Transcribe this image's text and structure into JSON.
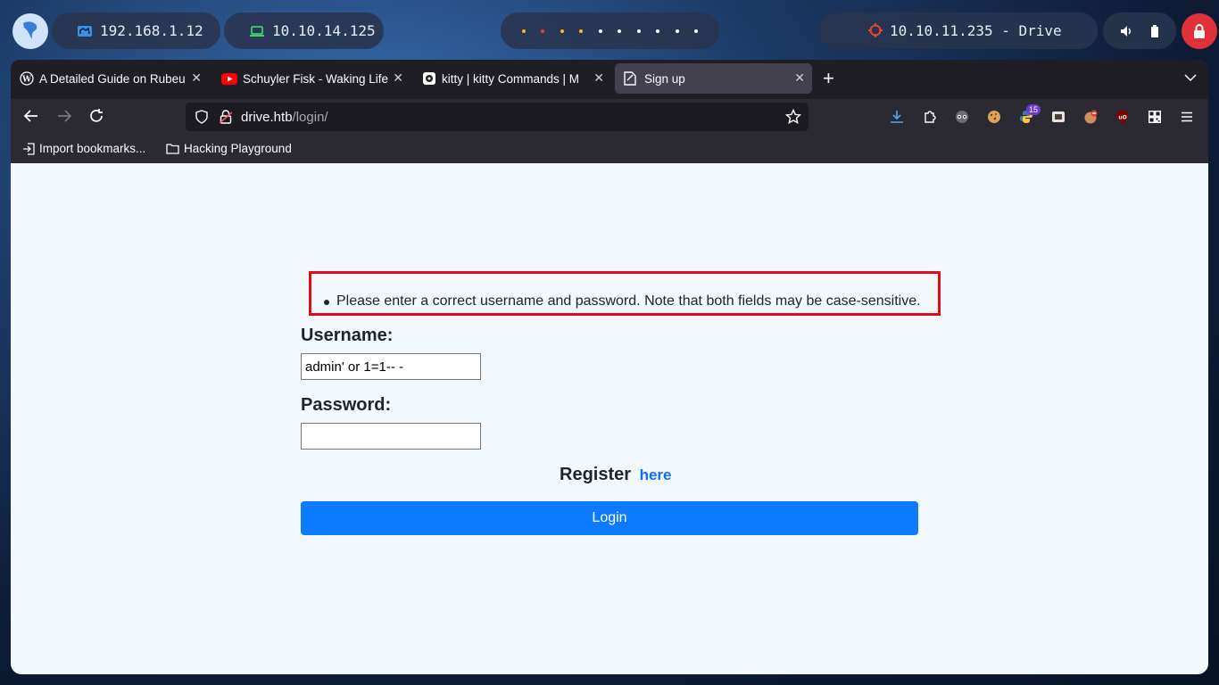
{
  "panel": {
    "local_ip": "192.168.1.12",
    "vpn_ip": "10.10.14.125",
    "target": "10.10.11.235 - Drive",
    "workspace_colors": [
      "#f5b826",
      "#e5422e",
      "#f5b826",
      "#f5b826",
      "#ffffff",
      "#ffffff",
      "#ffffff",
      "#ffffff",
      "#ffffff",
      "#ffffff"
    ]
  },
  "tabs": [
    {
      "title": "A Detailed Guide on Rubeus",
      "icon": "wordpress-icon",
      "active": false
    },
    {
      "title": "Schuyler Fisk - Waking Life",
      "icon": "youtube-icon",
      "active": false
    },
    {
      "title": "kitty | kitty Commands | M",
      "icon": "kitty-icon",
      "active": false
    },
    {
      "title": "Sign up",
      "icon": "page-icon",
      "active": true
    }
  ],
  "url": {
    "host": "drive.htb",
    "path": "/login/"
  },
  "toolbar": {
    "extension_badge": "15"
  },
  "bookmarks": [
    {
      "label": "Import bookmarks...",
      "icon": "import-icon"
    },
    {
      "label": "Hacking Playground",
      "icon": "folder-icon"
    }
  ],
  "form": {
    "error": "Please enter a correct username and password. Note that both fields may be case-sensitive.",
    "username_label": "Username:",
    "username_value": "admin' or 1=1-- -",
    "password_label": "Password:",
    "password_value": "",
    "register_text": "Register",
    "register_link": "here",
    "login_button": "Login"
  }
}
